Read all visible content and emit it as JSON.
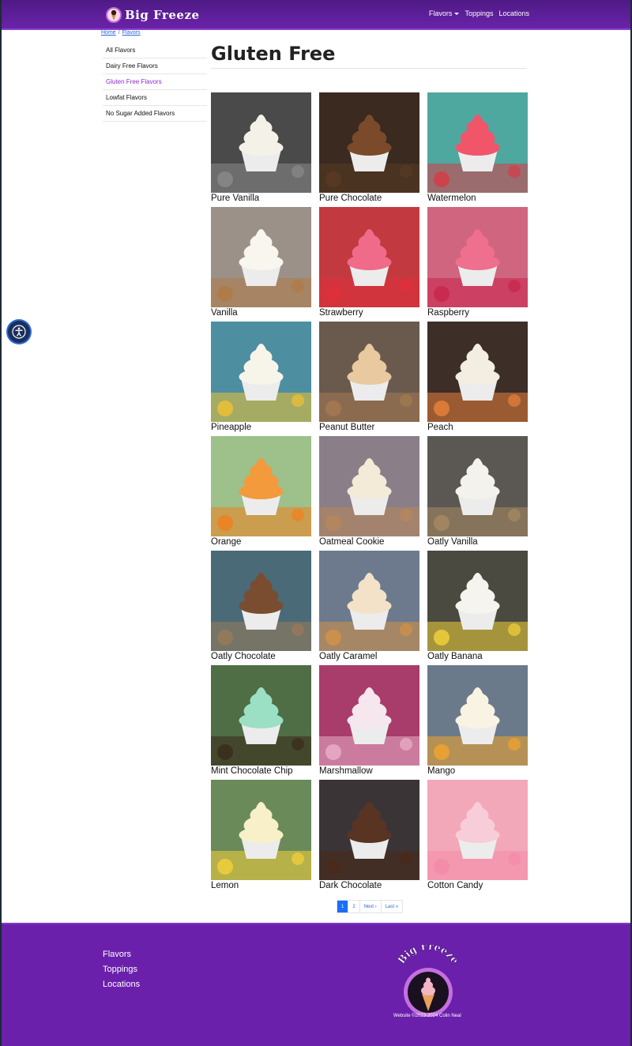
{
  "header": {
    "brand": "Big Freeze",
    "nav": [
      "Flavors",
      "Toppings",
      "Locations"
    ]
  },
  "breadcrumb": [
    "Home",
    "Flavors"
  ],
  "sidebar": {
    "items": [
      {
        "label": "All Flavors"
      },
      {
        "label": "Dairy Free Flavors"
      },
      {
        "label": "Gluten Free Flavors"
      },
      {
        "label": "Lowfat Flavors"
      },
      {
        "label": "No Sugar Added Flavors"
      }
    ],
    "active_index": 2
  },
  "main": {
    "title": "Gluten Free",
    "flavors": [
      {
        "name": "Pure Vanilla",
        "bg": "#4a4a4a",
        "cream": "#f4f1e8",
        "accent": "#8a8a8a"
      },
      {
        "name": "Pure Chocolate",
        "bg": "#3a2a20",
        "cream": "#7a4a2a",
        "accent": "#5a3a24"
      },
      {
        "name": "Watermelon",
        "bg": "#4fa8a0",
        "cream": "#f0556a",
        "accent": "#d83a45"
      },
      {
        "name": "Vanilla",
        "bg": "#9c9188",
        "cream": "#f8f6ef",
        "accent": "#b07a45"
      },
      {
        "name": "Strawberry",
        "bg": "#c23a40",
        "cream": "#f06a8a",
        "accent": "#e0303a"
      },
      {
        "name": "Raspberry",
        "bg": "#d06580",
        "cream": "#ee6f8e",
        "accent": "#c8244a"
      },
      {
        "name": "Pineapple",
        "bg": "#4d8ea0",
        "cream": "#f7f5ea",
        "accent": "#f1c232"
      },
      {
        "name": "Peanut Butter",
        "bg": "#6a5a4e",
        "cream": "#e8c9a0",
        "accent": "#a57a50"
      },
      {
        "name": "Peach",
        "bg": "#3d2e28",
        "cream": "#f3ede2",
        "accent": "#e8823a"
      },
      {
        "name": "Orange",
        "bg": "#9ec08a",
        "cream": "#f39a3c",
        "accent": "#f0801e"
      },
      {
        "name": "Oatmeal Cookie",
        "bg": "#8a7f88",
        "cream": "#f3ead8",
        "accent": "#b8875a"
      },
      {
        "name": "Oatly Vanilla",
        "bg": "#5b5753",
        "cream": "#f4f2ec",
        "accent": "#a88a62"
      },
      {
        "name": "Oatly Chocolate",
        "bg": "#4a6a78",
        "cream": "#7a4d30",
        "accent": "#9a7a5a"
      },
      {
        "name": "Oatly Caramel",
        "bg": "#6d7a8e",
        "cream": "#f3e2c8",
        "accent": "#d49245"
      },
      {
        "name": "Oatly Banana",
        "bg": "#4a4a40",
        "cream": "#f6f4ee",
        "accent": "#f2d23a"
      },
      {
        "name": "Mint Chocolate Chip",
        "bg": "#4f6e46",
        "cream": "#9be0c4",
        "accent": "#3a2a1a"
      },
      {
        "name": "Marshmallow",
        "bg": "#a83c6a",
        "cream": "#f6e6ee",
        "accent": "#e8b0c8"
      },
      {
        "name": "Mango",
        "bg": "#6a7a8a",
        "cream": "#f8f3e2",
        "accent": "#f3a42a"
      },
      {
        "name": "Lemon",
        "bg": "#6a8a5a",
        "cream": "#f7f0c8",
        "accent": "#f4d23a"
      },
      {
        "name": "Dark Chocolate",
        "bg": "#3a3436",
        "cream": "#5a3422",
        "accent": "#4a2a1a"
      },
      {
        "name": "Cotton Candy",
        "bg": "#f2a8b8",
        "cream": "#f6cdd8",
        "accent": "#f48aa8"
      }
    ]
  },
  "pagination": [
    "1",
    "2",
    "Next ›",
    "Last »"
  ],
  "footer": {
    "links": [
      "Flavors",
      "Toppings",
      "Locations"
    ],
    "logo_text": "Big Freeze",
    "copyright": "Website ©2023-2024 Colin Neal"
  },
  "colors": {
    "brand_purple": "#6a20ab",
    "active_link": "#8c2bd1",
    "pager_active": "#1a6ef7"
  },
  "icons": {
    "accessibility": "accessibility-icon",
    "brand": "ice-cream-cone-icon"
  }
}
